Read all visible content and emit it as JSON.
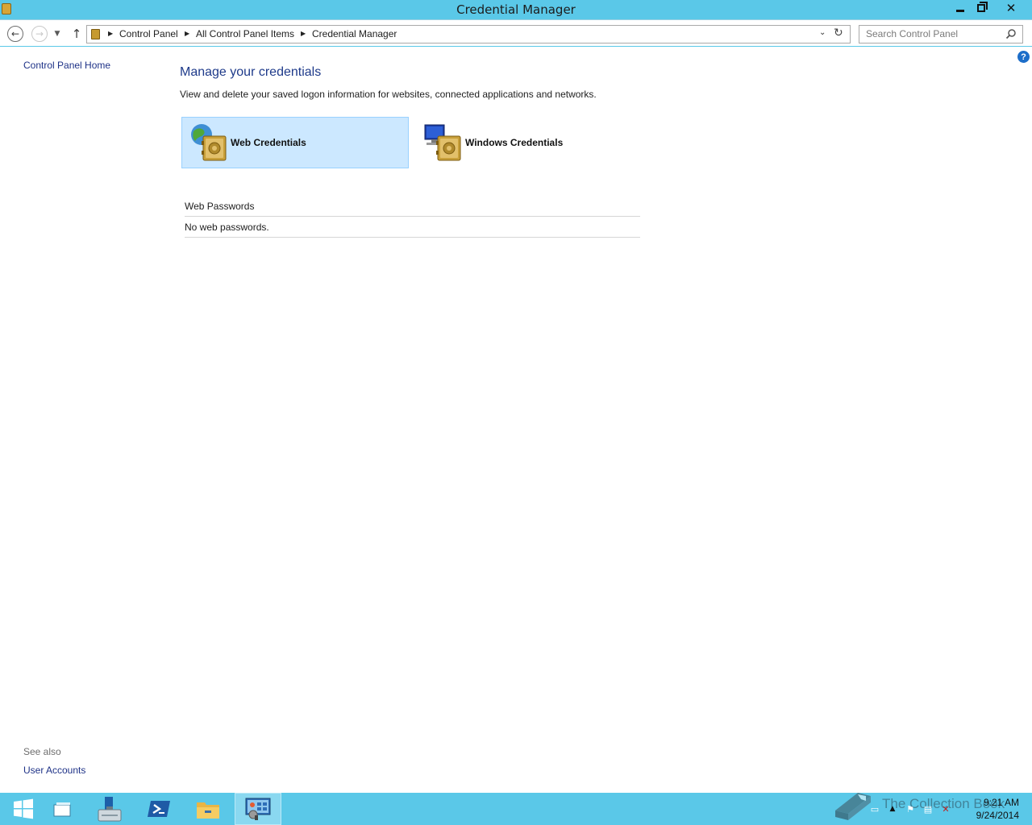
{
  "window": {
    "title": "Credential Manager",
    "controls": {
      "minimize": "minimize-icon",
      "maximize": "restore-icon",
      "close": "close-icon"
    }
  },
  "nav": {
    "breadcrumb": [
      "Control Panel",
      "All Control Panel Items",
      "Credential Manager"
    ],
    "search": {
      "placeholder": "Search Control Panel",
      "value": ""
    }
  },
  "sidebar": {
    "home_link": "Control Panel Home",
    "see_also_label": "See also",
    "see_also_links": [
      "User Accounts"
    ]
  },
  "main": {
    "title": "Manage your credentials",
    "description": "View and delete your saved logon information for websites, connected applications and networks.",
    "tiles": [
      {
        "label": "Web Credentials",
        "selected": true,
        "icon": "web-credentials-vault-icon"
      },
      {
        "label": "Windows Credentials",
        "selected": false,
        "icon": "windows-credentials-vault-icon"
      }
    ],
    "section_header": "Web Passwords",
    "empty_message": "No web passwords."
  },
  "taskbar": {
    "items": [
      "start-icon",
      "task-view-icon",
      "server-manager-icon",
      "powershell-icon",
      "file-explorer-icon",
      "control-panel-icon"
    ],
    "active_item": "control-panel-icon",
    "clock_time": "9:21 AM",
    "clock_date": "9/24/2014",
    "watermark": "The Collection Book"
  },
  "colors": {
    "chrome_accent": "#5ac8e8",
    "selected_tile": "#cce8ff",
    "link": "#1e3287",
    "heading": "#1e3a8a"
  }
}
